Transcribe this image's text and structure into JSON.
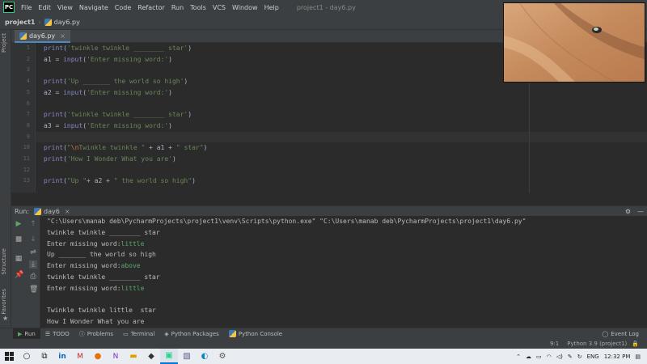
{
  "menu": {
    "logo": "PC",
    "items": [
      "File",
      "Edit",
      "View",
      "Navigate",
      "Code",
      "Refactor",
      "Run",
      "Tools",
      "VCS",
      "Window",
      "Help"
    ],
    "window_title": "project1 - day6.py"
  },
  "nav": {
    "project": "project1",
    "file": "day6.py"
  },
  "sidebar": {
    "project_tab": "Project",
    "structure_tab": "Structure",
    "favorites_tab": "Favorites"
  },
  "editor": {
    "tab_label": "day6.py",
    "line_numbers": [
      "1",
      "2",
      "3",
      "4",
      "5",
      "6",
      "7",
      "8",
      "9",
      "10",
      "11",
      "12",
      "13"
    ],
    "lines": [
      {
        "parts": [
          {
            "t": "print",
            "c": "fn"
          },
          {
            "t": "(",
            "c": ""
          },
          {
            "t": "'twinkle twinkle ________ star'",
            "c": "str"
          },
          {
            "t": ")",
            "c": ""
          }
        ]
      },
      {
        "parts": [
          {
            "t": "a1 = ",
            "c": ""
          },
          {
            "t": "input",
            "c": "fn"
          },
          {
            "t": "(",
            "c": ""
          },
          {
            "t": "'Enter missing word:'",
            "c": "str"
          },
          {
            "t": ")",
            "c": ""
          }
        ]
      },
      {
        "parts": []
      },
      {
        "parts": [
          {
            "t": "print",
            "c": "fn"
          },
          {
            "t": "(",
            "c": ""
          },
          {
            "t": "'Up _______ the world so high'",
            "c": "str"
          },
          {
            "t": ")",
            "c": ""
          }
        ]
      },
      {
        "parts": [
          {
            "t": "a2 = ",
            "c": ""
          },
          {
            "t": "input",
            "c": "fn"
          },
          {
            "t": "(",
            "c": ""
          },
          {
            "t": "'Enter missing word:'",
            "c": "str"
          },
          {
            "t": ")",
            "c": ""
          }
        ]
      },
      {
        "parts": []
      },
      {
        "parts": [
          {
            "t": "print",
            "c": "fn"
          },
          {
            "t": "(",
            "c": ""
          },
          {
            "t": "'twinkle twinkle ________ star'",
            "c": "str"
          },
          {
            "t": ")",
            "c": ""
          }
        ]
      },
      {
        "parts": [
          {
            "t": "a3 = ",
            "c": ""
          },
          {
            "t": "input",
            "c": "fn"
          },
          {
            "t": "(",
            "c": ""
          },
          {
            "t": "'Enter missing word:'",
            "c": "str"
          },
          {
            "t": ")",
            "c": ""
          }
        ]
      },
      {
        "parts": []
      },
      {
        "parts": [
          {
            "t": "print",
            "c": "fn"
          },
          {
            "t": "(",
            "c": ""
          },
          {
            "t": "\"",
            "c": "str"
          },
          {
            "t": "\\n",
            "c": "esc"
          },
          {
            "t": "Twinkle twinkle \"",
            "c": "str"
          },
          {
            "t": " + a1 + ",
            "c": ""
          },
          {
            "t": "\" star\"",
            "c": "str"
          },
          {
            "t": ")",
            "c": ""
          }
        ]
      },
      {
        "parts": [
          {
            "t": "print",
            "c": "fn"
          },
          {
            "t": "(",
            "c": ""
          },
          {
            "t": "'How I Wonder What you are'",
            "c": "str"
          },
          {
            "t": ")",
            "c": ""
          }
        ]
      },
      {
        "parts": []
      },
      {
        "parts": [
          {
            "t": "print",
            "c": "fn"
          },
          {
            "t": "(",
            "c": ""
          },
          {
            "t": "\"Up \"",
            "c": "str"
          },
          {
            "t": "+ a2 + ",
            "c": ""
          },
          {
            "t": "\" the world so high\"",
            "c": "str"
          },
          {
            "t": ")",
            "c": ""
          }
        ]
      }
    ]
  },
  "run": {
    "label": "Run:",
    "config": "day6",
    "console": [
      {
        "parts": [
          {
            "t": "\"C:\\Users\\manab deb\\PycharmProjects\\project1\\venv\\Scripts\\python.exe\" \"C:\\Users\\manab deb\\PycharmProjects\\project1\\day6.py\"",
            "c": ""
          }
        ]
      },
      {
        "parts": [
          {
            "t": "twinkle twinkle ________ star",
            "c": ""
          }
        ]
      },
      {
        "parts": [
          {
            "t": "Enter missing word:",
            "c": ""
          },
          {
            "t": "little",
            "c": "inp"
          }
        ]
      },
      {
        "parts": [
          {
            "t": "Up _______ the world so high",
            "c": ""
          }
        ]
      },
      {
        "parts": [
          {
            "t": "Enter missing word:",
            "c": ""
          },
          {
            "t": "above",
            "c": "inp"
          }
        ]
      },
      {
        "parts": [
          {
            "t": "twinkle twinkle ________ star",
            "c": ""
          }
        ]
      },
      {
        "parts": [
          {
            "t": "Enter missing word:",
            "c": ""
          },
          {
            "t": "little",
            "c": "inp"
          }
        ]
      },
      {
        "parts": []
      },
      {
        "parts": [
          {
            "t": "Twinkle twinkle little  star",
            "c": ""
          }
        ]
      },
      {
        "parts": [
          {
            "t": "How I Wonder What you are",
            "c": ""
          }
        ]
      }
    ]
  },
  "toolwindows": {
    "run": "Run",
    "todo": "TODO",
    "problems": "Problems",
    "terminal": "Terminal",
    "packages": "Python Packages",
    "console": "Python Console",
    "event_log": "Event Log"
  },
  "status": {
    "position": "9:1",
    "interpreter": "Python 3.9 (project1)"
  },
  "taskbar": {
    "lang": "ENG",
    "time": "12:32 PM"
  }
}
